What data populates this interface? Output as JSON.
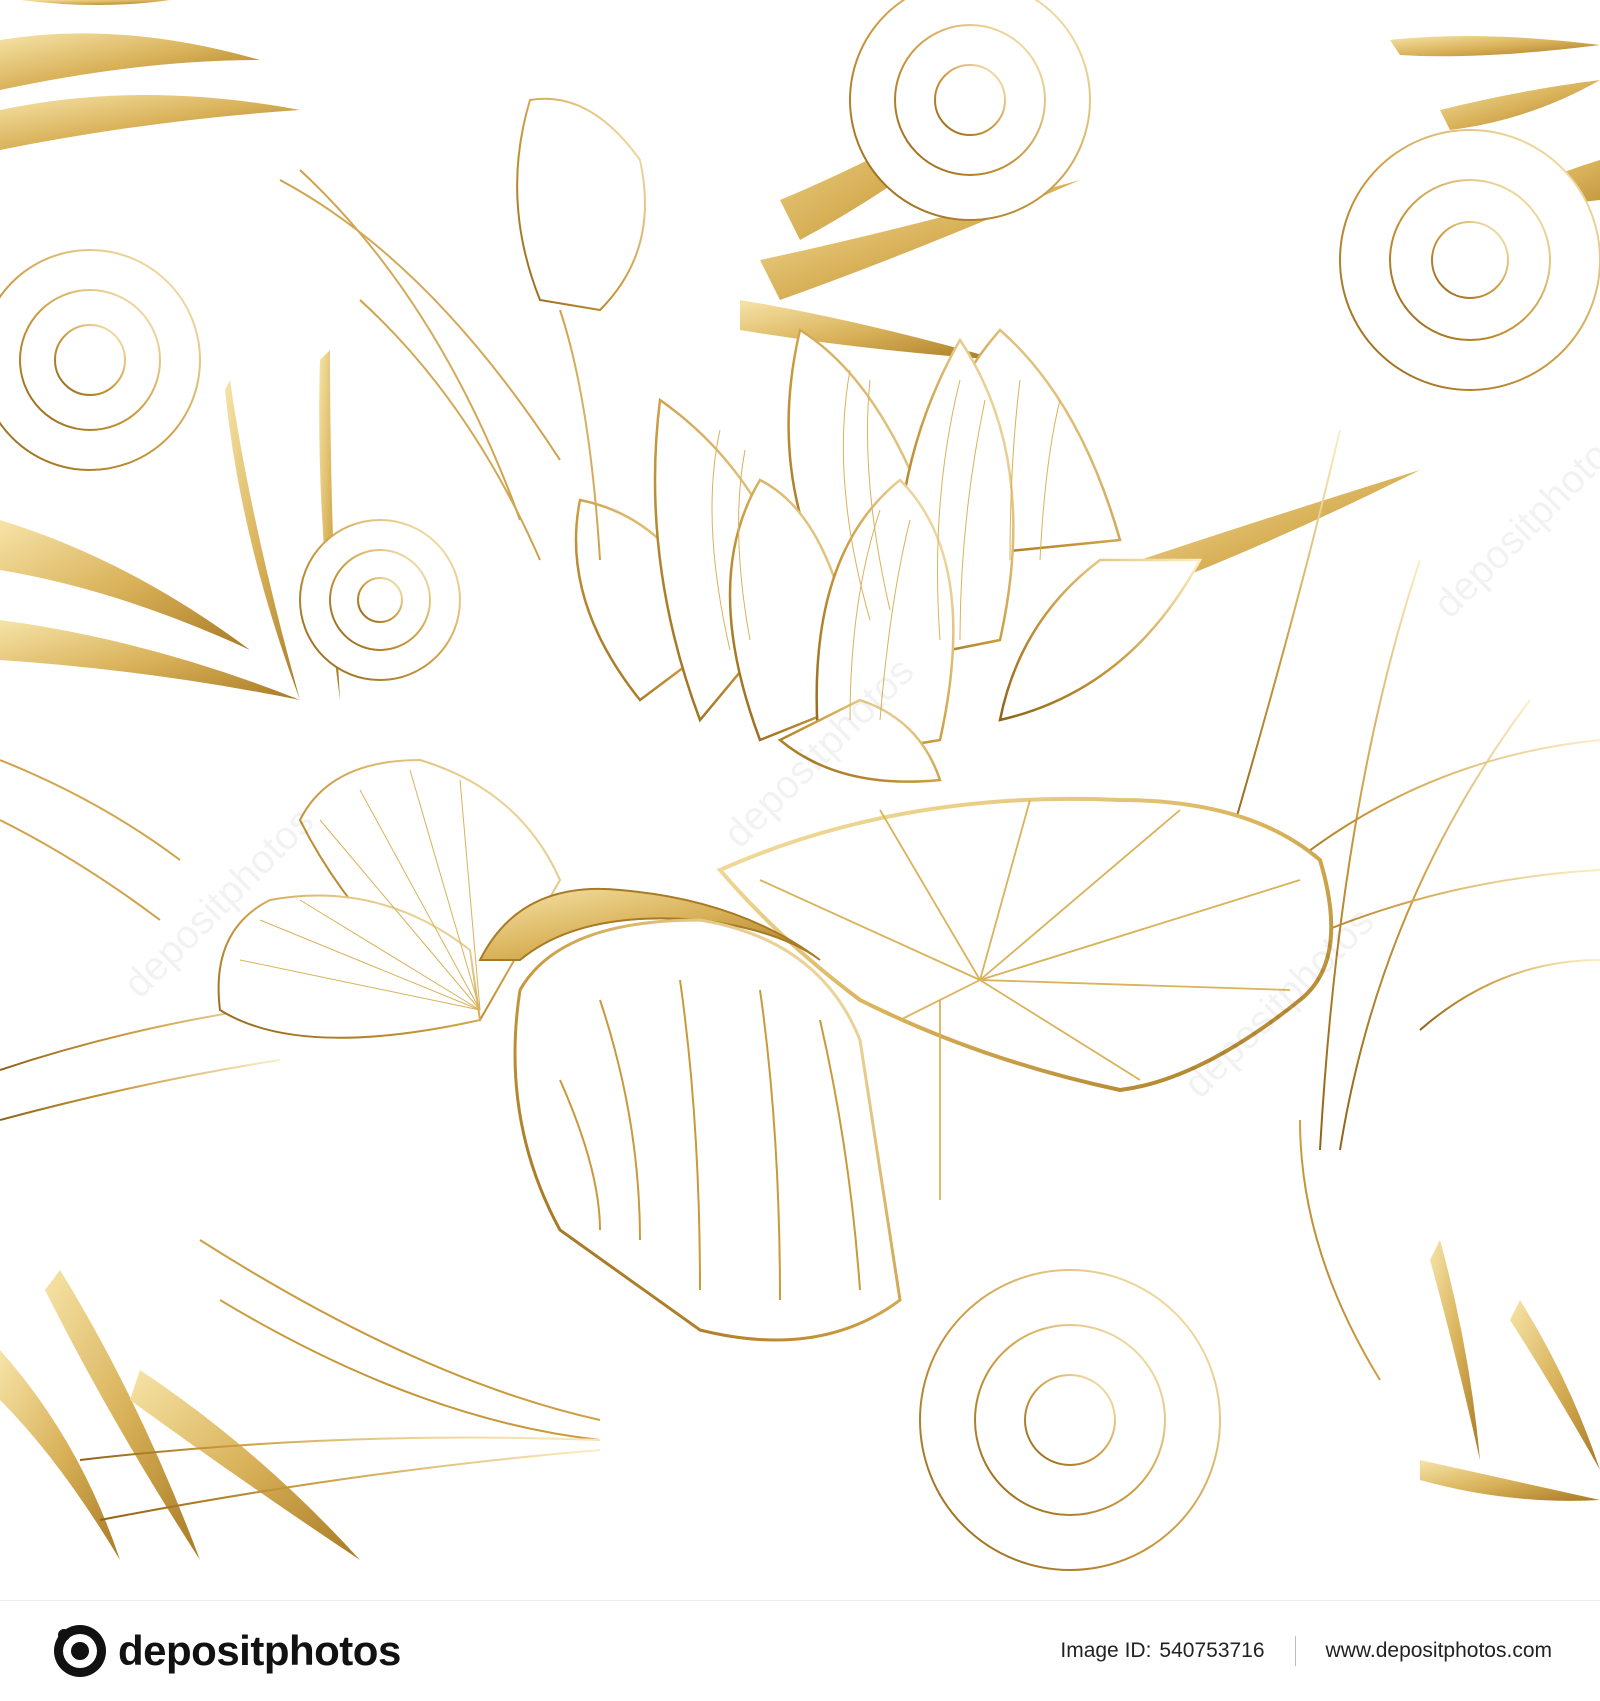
{
  "artwork": {
    "palette": {
      "gold_light": "#f4e1a4",
      "gold_mid": "#d9b25a",
      "gold_dark": "#a87a24",
      "background": "#ffffff"
    },
    "watermark_text": "depositphotos"
  },
  "footer": {
    "brand_name": "depositphotos",
    "logo_icon": "camera-aperture-icon",
    "image_id_label": "Image ID:",
    "image_id_value": "540753716",
    "site_url": "www.depositphotos.com"
  }
}
